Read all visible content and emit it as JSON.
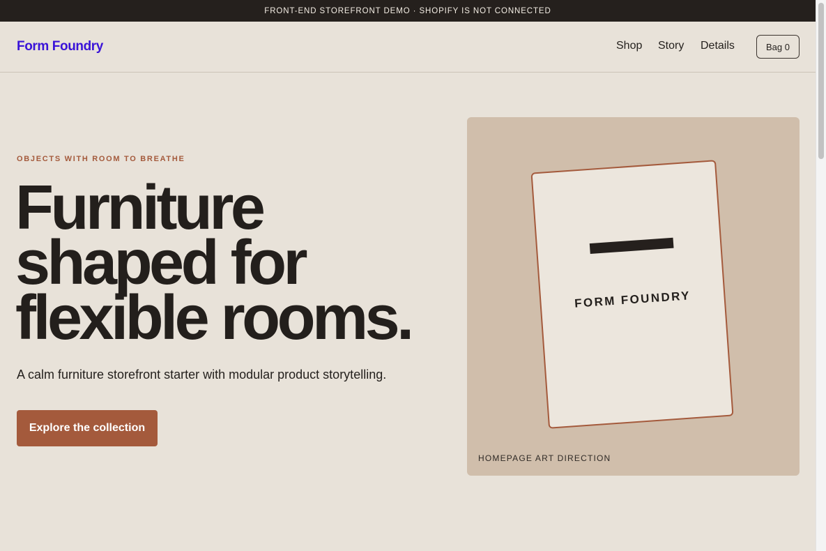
{
  "announcement": "FRONT-END STOREFRONT DEMO · SHOPIFY IS NOT CONNECTED",
  "header": {
    "brand": "Form Foundry",
    "nav": [
      "Shop",
      "Story",
      "Details"
    ],
    "bag_label": "Bag 0"
  },
  "hero": {
    "eyebrow": "OBJECTS WITH ROOM TO BREATHE",
    "headline": [
      "Furniture",
      "shaped for",
      "flexible rooms."
    ],
    "subcopy": "A calm furniture storefront starter with modular product storytelling.",
    "cta_label": "Explore the collection"
  },
  "art": {
    "card_wordmark": "FORM FOUNDRY",
    "caption": "HOMEPAGE ART DIRECTION"
  },
  "colors": {
    "accent": "#a45a3c",
    "brand_link": "#3a13d8",
    "background": "#e8e2d9",
    "announcement_bar": "#25201d",
    "art_panel": "#d0beab"
  }
}
